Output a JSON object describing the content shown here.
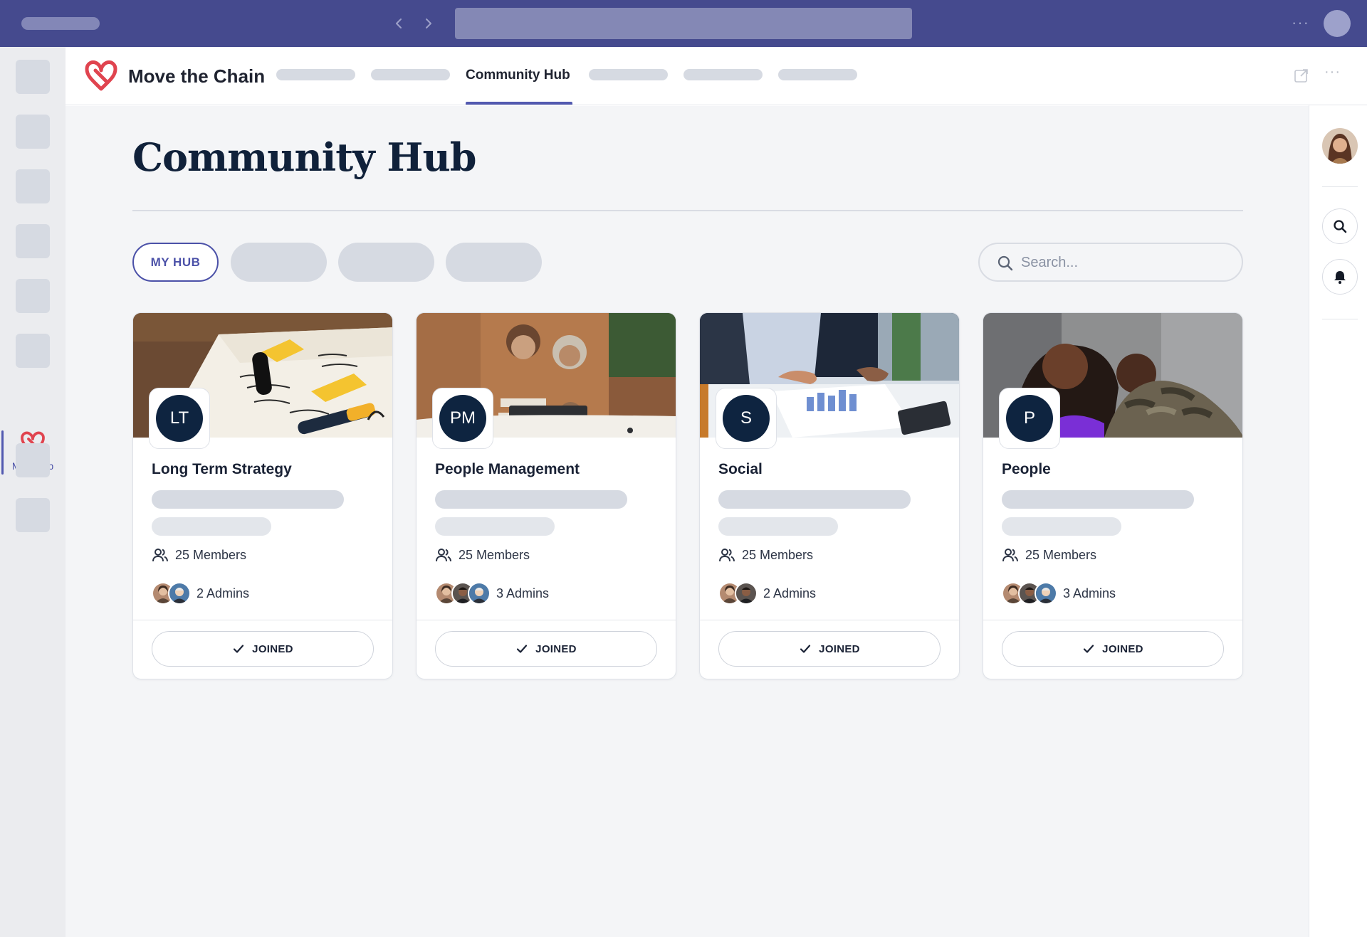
{
  "app": {
    "name": "Move the Chain",
    "rail_app_label": "MTC App",
    "active_tab": "Community Hub"
  },
  "colors": {
    "titlebar": "#454a8e",
    "accent": "#4b51a8",
    "brand_red": "#e0444f",
    "badge_navy": "#0e2440",
    "page_bg": "#f4f5f7"
  },
  "page": {
    "title": "Community Hub",
    "filter_active_label": "MY HUB",
    "search_placeholder": "Search..."
  },
  "header_icons": [
    "popout-icon",
    "more-icon"
  ],
  "right_rail_icons": [
    "search-icon",
    "bell-icon"
  ],
  "cards": [
    {
      "initials": "LT",
      "title": "Long Term Strategy",
      "members": "25 Members",
      "admins": "2 Admins",
      "admin_count": 2,
      "button": "JOINED",
      "image": "notebook-sketch-photo"
    },
    {
      "initials": "PM",
      "title": "People Management",
      "members": "25 Members",
      "admins": "3 Admins",
      "admin_count": 3,
      "button": "JOINED",
      "image": "colleagues-laptop-photo"
    },
    {
      "initials": "S",
      "title": "Social",
      "members": "25 Members",
      "admins": "2 Admins",
      "admin_count": 2,
      "button": "JOINED",
      "image": "business-charts-photo"
    },
    {
      "initials": "P",
      "title": "People",
      "members": "25 Members",
      "admins": "3 Admins",
      "admin_count": 3,
      "button": "JOINED",
      "image": "friends-embrace-photo"
    }
  ]
}
